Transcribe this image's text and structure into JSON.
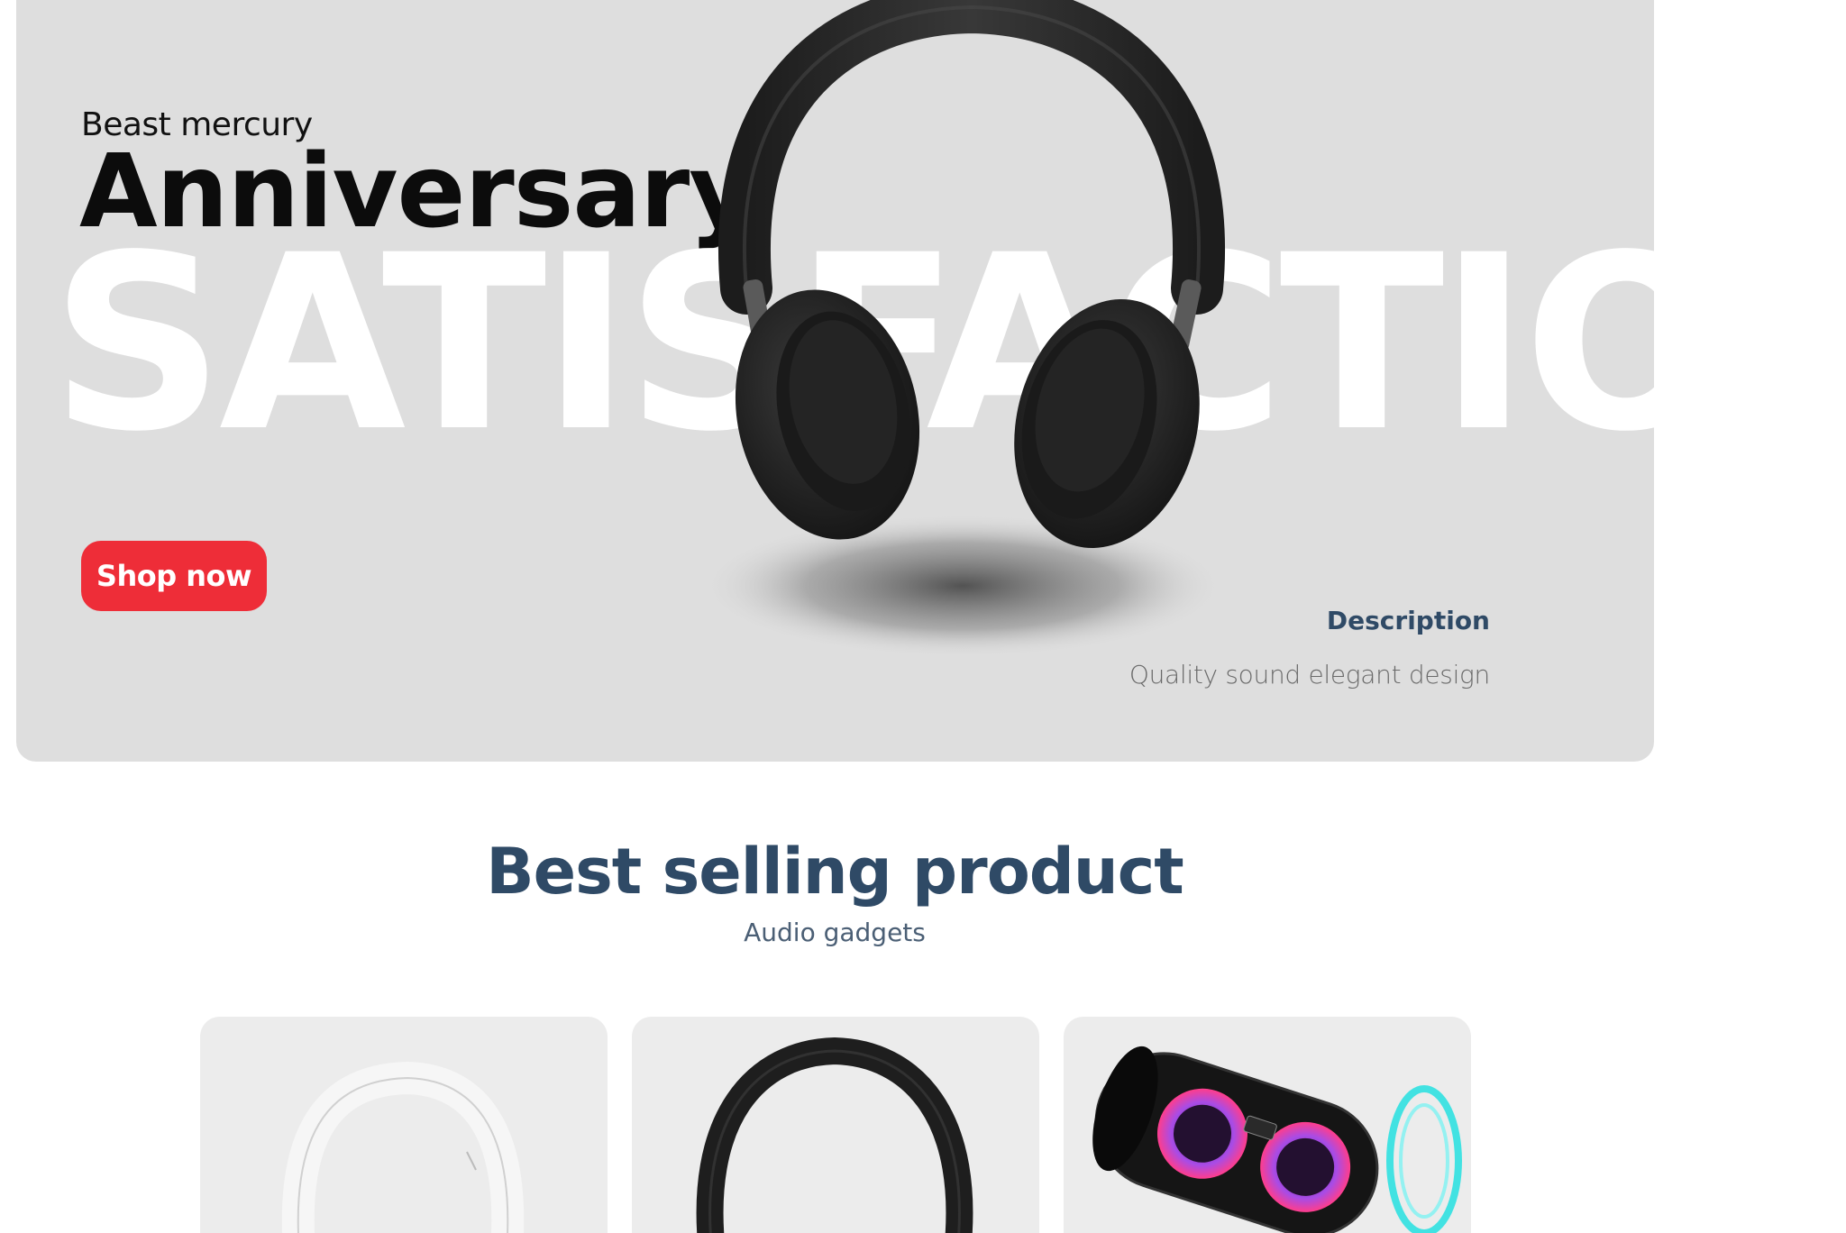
{
  "hero": {
    "subtitle": "Beast mercury",
    "title": "Anniversary",
    "background_text": "SATISFACTIO",
    "cta_label": "Shop now",
    "description_label": "Description",
    "description_text": "Quality sound elegant design",
    "cta_color": "#ee2d38",
    "background_color": "#dedede"
  },
  "products_section": {
    "title": "Best selling product",
    "subtitle": "Audio gadgets",
    "title_color": "#2f4a66",
    "products": [
      {
        "image": "white-headphones-image"
      },
      {
        "image": "black-headphones-image"
      },
      {
        "image": "speaker-image"
      }
    ]
  }
}
